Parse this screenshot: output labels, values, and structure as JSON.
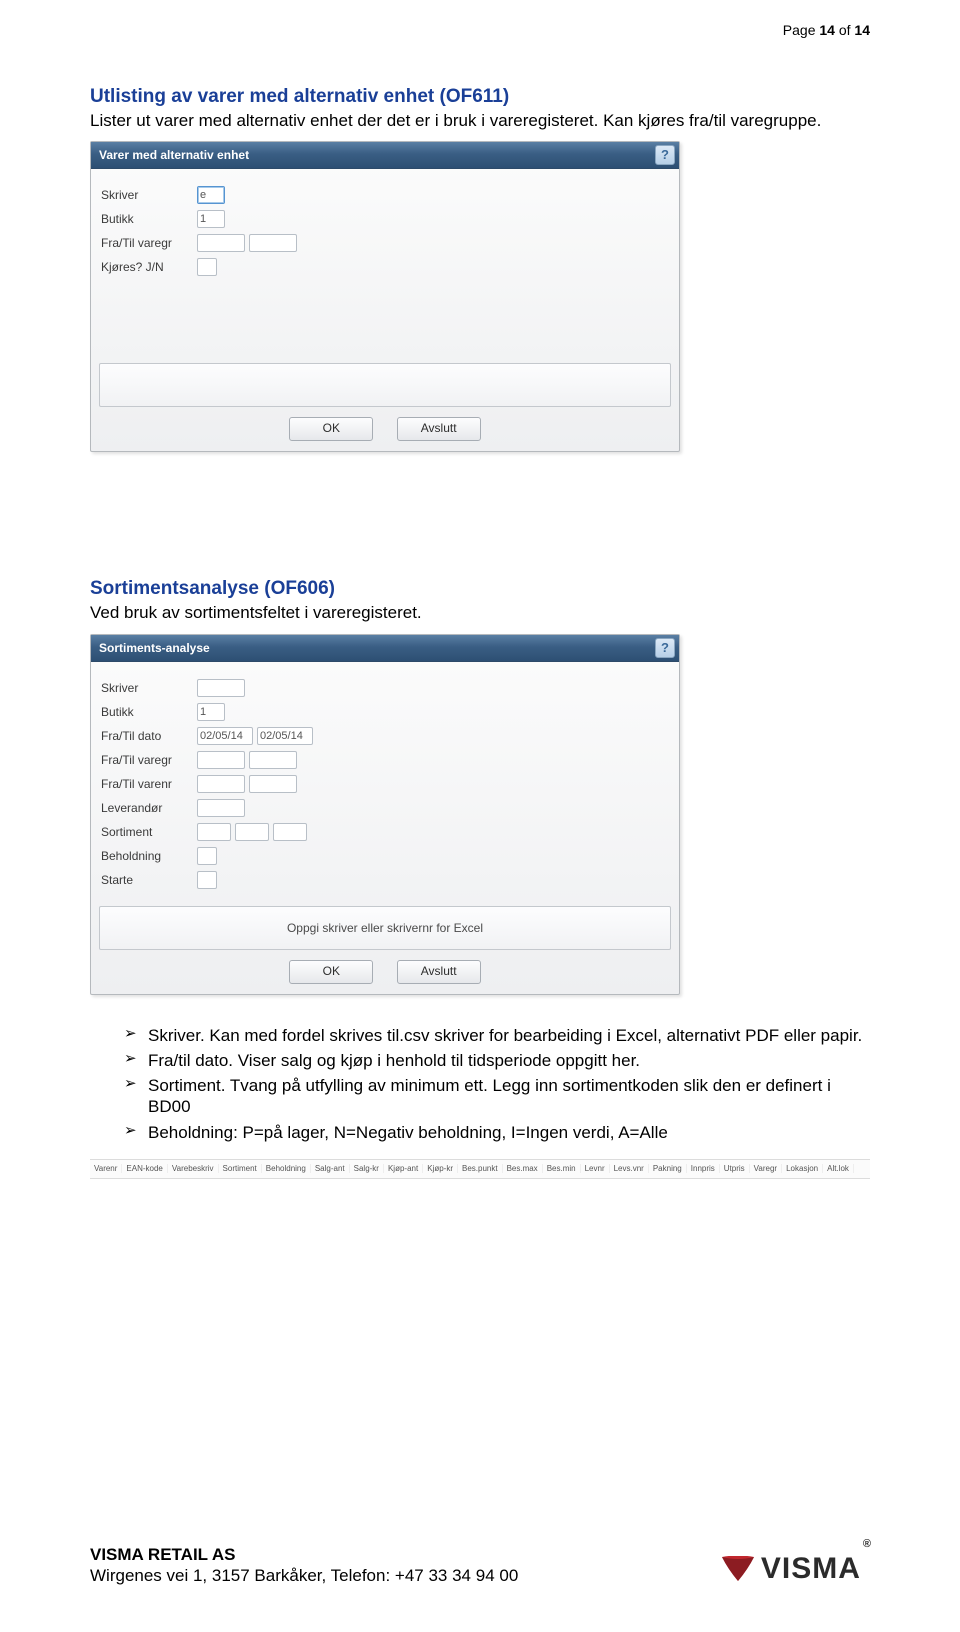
{
  "pagenum": {
    "prefix": "Page ",
    "current": "14",
    "of": " of ",
    "total": "14"
  },
  "section1": {
    "title": "Utlisting av varer med alternativ enhet (OF611)",
    "text": "Lister ut varer med alternativ enhet der det er i bruk i vareregisteret. Kan kjøres fra/til varegruppe."
  },
  "dialog1": {
    "title": "Varer med alternativ enhet",
    "help": "?",
    "labels": {
      "skriver": "Skriver",
      "butikk": "Butikk",
      "fratil_varegr": "Fra/Til varegr",
      "kjores": "Kjøres? J/N"
    },
    "values": {
      "skriver": "e",
      "butikk": "1"
    },
    "status": "",
    "buttons": {
      "ok": "OK",
      "avslutt": "Avslutt"
    }
  },
  "section2": {
    "title": "Sortimentsanalyse (OF606)",
    "text": "Ved bruk av sortimentsfeltet i vareregisteret."
  },
  "dialog2": {
    "title": "Sortiments-analyse",
    "help": "?",
    "labels": {
      "skriver": "Skriver",
      "butikk": "Butikk",
      "fratil_dato": "Fra/Til dato",
      "fratil_varegr": "Fra/Til varegr",
      "fratil_varenr": "Fra/Til varenr",
      "leverandor": "Leverandør",
      "sortiment": "Sortiment",
      "beholdning": "Beholdning",
      "starte": "Starte"
    },
    "values": {
      "butikk": "1",
      "dato_fra": "02/05/14",
      "dato_til": "02/05/14"
    },
    "status": "Oppgi skriver eller skrivernr for Excel",
    "buttons": {
      "ok": "OK",
      "avslutt": "Avslutt"
    }
  },
  "bullets": [
    "Skriver. Kan med fordel skrives til.csv skriver for bearbeiding i Excel, alternativt PDF eller papir.",
    "Fra/til dato. Viser salg og kjøp i henhold til tidsperiode oppgitt her.",
    "Sortiment. Tvang på utfylling av minimum ett. Legg inn sortimentkoden slik den er definert i BD00",
    "Beholdning: P=på lager, N=Negativ beholdning, I=Ingen verdi, A=Alle"
  ],
  "columns": [
    "Varenr",
    "EAN-kode",
    "Varebeskriv",
    "Sortiment",
    "Beholdning",
    "Salg-ant",
    "Salg-kr",
    "Kjøp-ant",
    "Kjøp-kr",
    "Bes.punkt",
    "Bes.max",
    "Bes.min",
    "Levnr",
    "Levs.vnr",
    "Pakning",
    "Innpris",
    "Utpris",
    "Varegr",
    "Lokasjon",
    "Alt.lok"
  ],
  "footer": {
    "company": "VISMA RETAIL AS",
    "address": "Wirgenes vei 1, 3157 Barkåker, Telefon: +47 33 34 94 00",
    "logo_word": "VISMA",
    "reg": "®"
  }
}
